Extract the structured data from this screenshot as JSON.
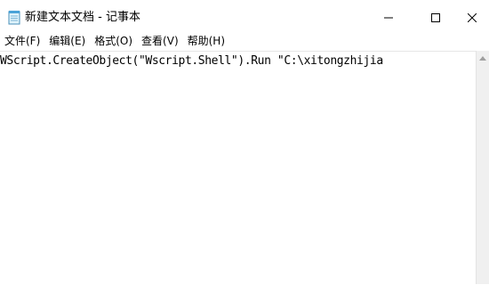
{
  "window": {
    "title": "新建文本文档 - 记事本",
    "icon": "notepad-icon",
    "controls": {
      "minimize_icon": "minimize-icon",
      "maximize_icon": "maximize-icon",
      "close_icon": "close-icon"
    }
  },
  "menu": {
    "items": [
      {
        "label": "文件(F)"
      },
      {
        "label": "编辑(E)"
      },
      {
        "label": "格式(O)"
      },
      {
        "label": "查看(V)"
      },
      {
        "label": "帮助(H)"
      }
    ]
  },
  "editor": {
    "content": "WScript.CreateObject(\"Wscript.Shell\").Run \"C:\\xitongzhijia"
  }
}
